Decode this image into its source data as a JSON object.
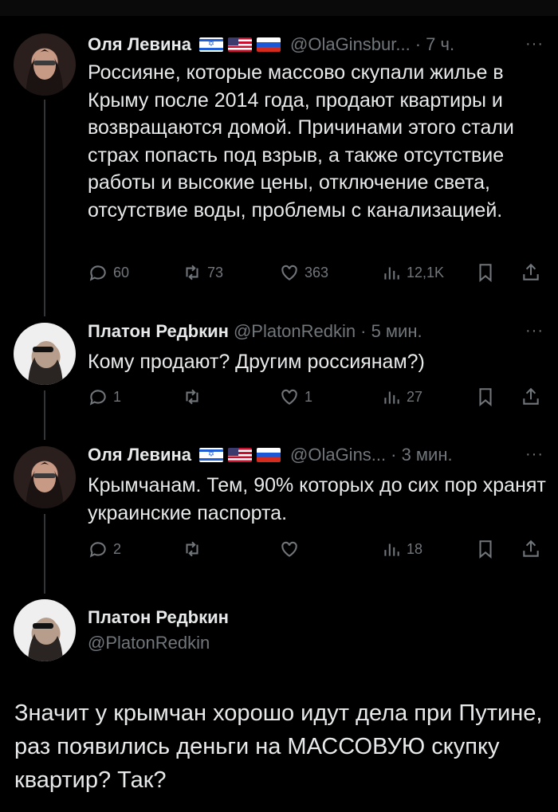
{
  "tweets": [
    {
      "name": "Оля Левина",
      "handle": "@OlaGinsbur...",
      "time": "· 7 ч.",
      "text": "Россияне, которые массово скупали жилье в Крыму после 2014 года, продают квартиры и возвращаются домой. Причинами этого стали страх попасть под взрыв, а также отсутствие работы и высокие цены, отключение света, отсутствие воды, проблемы с канализацией.",
      "replies": "60",
      "reposts": "73",
      "likes": "363",
      "views": "12,1K"
    },
    {
      "name": "Платон Редbкин",
      "handle": "@PlatonRedkin",
      "time": "· 5 мин.",
      "text": "Кому продают? Другим россиянам?)",
      "replies": "1",
      "reposts": "",
      "likes": "1",
      "views": "27"
    },
    {
      "name": "Оля Левина",
      "handle": "@OlaGins...",
      "time": "· 3 мин.",
      "text": "Крымчанам. Тем, 90% которых до сих пор хранят украинские паспорта.",
      "replies": "2",
      "reposts": "",
      "likes": "",
      "views": "18"
    }
  ],
  "main_tweet": {
    "name": "Платон Редbкин",
    "handle": "@PlatonRedkin",
    "text": "Значит у крымчан хорошо идут дела при Путине, раз появились деньги на МАССОВУЮ скупку квартир? Так?"
  },
  "more_label": "···",
  "icons": [
    "reply-icon",
    "repost-icon",
    "like-icon",
    "views-icon",
    "bookmark-icon",
    "share-icon"
  ],
  "colors": {
    "background": "#000000",
    "text": "#e7e9ea",
    "muted": "#71767b",
    "thread_line": "#333639"
  }
}
